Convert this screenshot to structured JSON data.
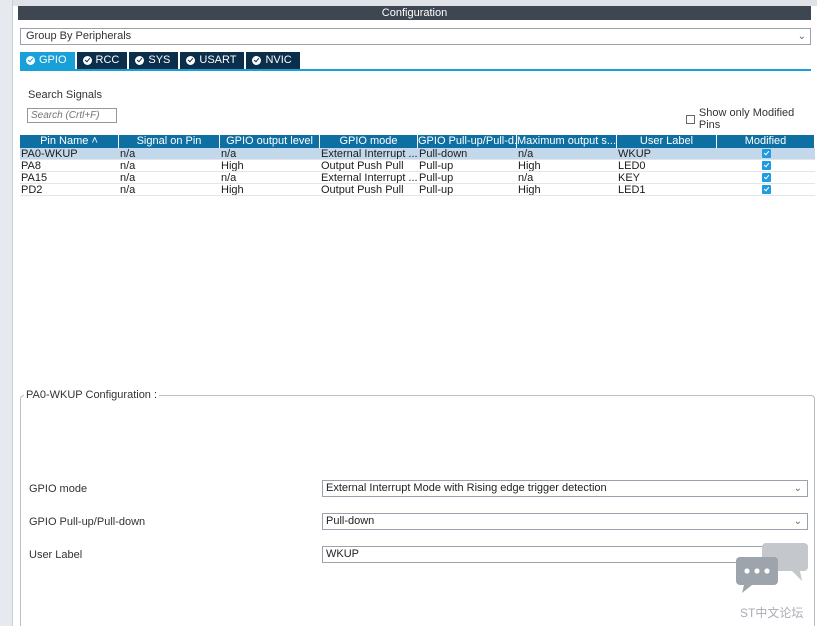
{
  "window": {
    "title": "Configuration"
  },
  "group_select": {
    "value": "Group By Peripherals"
  },
  "tabs": [
    {
      "label": "GPIO",
      "active": true
    },
    {
      "label": "RCC",
      "active": false
    },
    {
      "label": "SYS",
      "active": false
    },
    {
      "label": "USART",
      "active": false
    },
    {
      "label": "NVIC",
      "active": false
    }
  ],
  "search": {
    "label": "Search Signals",
    "placeholder": "Search (Crtl+F)"
  },
  "show_modified": {
    "label": "Show only Modified Pins",
    "checked": false
  },
  "table": {
    "columns": [
      "Pin Name",
      "Signal on Pin",
      "GPIO output level",
      "GPIO mode",
      "GPIO Pull-up/Pull-d...",
      "Maximum output s...",
      "User Label",
      "Modified"
    ],
    "sort_indicator": "˄",
    "rows": [
      {
        "pin": "PA0-WKUP",
        "signal": "n/a",
        "level": "n/a",
        "mode": "External Interrupt ...",
        "pull": "Pull-down",
        "speed": "n/a",
        "label": "WKUP",
        "modified": true,
        "selected": true
      },
      {
        "pin": "PA8",
        "signal": "n/a",
        "level": "High",
        "mode": "Output Push Pull",
        "pull": "Pull-up",
        "speed": "High",
        "label": "LED0",
        "modified": true,
        "selected": false
      },
      {
        "pin": "PA15",
        "signal": "n/a",
        "level": "n/a",
        "mode": "External Interrupt ...",
        "pull": "Pull-up",
        "speed": "n/a",
        "label": "KEY",
        "modified": true,
        "selected": false
      },
      {
        "pin": "PD2",
        "signal": "n/a",
        "level": "High",
        "mode": "Output Push Pull",
        "pull": "Pull-up",
        "speed": "High",
        "label": "LED1",
        "modified": true,
        "selected": false
      }
    ]
  },
  "config": {
    "title": "PA0-WKUP Configuration :",
    "gpio_mode": {
      "label": "GPIO mode",
      "value": "External Interrupt Mode with Rising edge trigger detection"
    },
    "pull": {
      "label": "GPIO Pull-up/Pull-down",
      "value": "Pull-down"
    },
    "user_label": {
      "label": "User Label",
      "value": "WKUP"
    }
  },
  "watermark": {
    "text": "ST中文论坛"
  },
  "icons": {
    "dropdown": "chevron-down-icon",
    "tab_status": "check-circle-icon",
    "chat": "chat-bubble-icon"
  },
  "colors": {
    "tab_active": "#18a0d8",
    "tab_inactive": "#0b2e4a",
    "table_header": "#0e6fa3",
    "selected_row": "#c4d8ec",
    "title_bar": "#3d4651"
  }
}
